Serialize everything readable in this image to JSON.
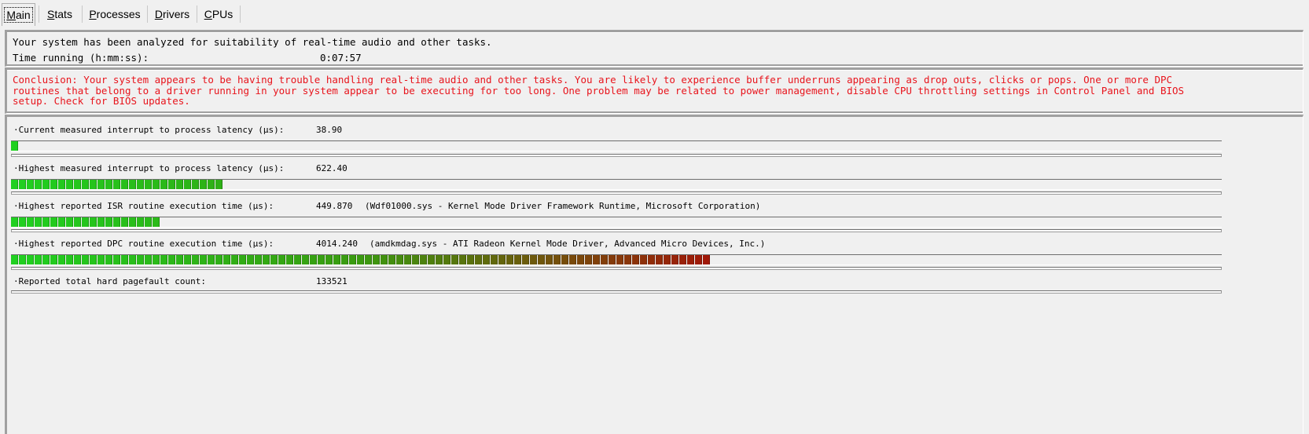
{
  "tabs": [
    {
      "label": "Main",
      "active": true
    },
    {
      "label": "Stats",
      "active": false
    },
    {
      "label": "Processes",
      "active": false
    },
    {
      "label": "Drivers",
      "active": false
    },
    {
      "label": "CPUs",
      "active": false
    }
  ],
  "summary": {
    "analyzed_text": "Your system has been analyzed for suitability of real-time audio and other tasks.",
    "time_running_label": "Time running (h:mm:ss):",
    "time_running_value": "0:07:57"
  },
  "conclusion": {
    "text": "Conclusion: Your system appears to be having trouble handling real-time audio and other tasks. You are likely to experience buffer underruns appearing as drop outs, clicks or pops. One or more DPC routines that belong to a driver running in your system appear to be executing for too long. One problem may be related to power management, disable CPU throttling settings in Control Panel and BIOS setup. Check for BIOS updates.",
    "color": "#e8141c"
  },
  "metrics": [
    {
      "label": "·Current measured interrupt to process latency (µs):",
      "value": "38.90",
      "extra": "",
      "bar_segments": 1
    },
    {
      "label": "·Highest measured interrupt to process latency (µs):",
      "value": "622.40",
      "extra": "",
      "bar_segments": 27
    },
    {
      "label": "·Highest reported ISR routine execution time (µs):",
      "value": "449.870",
      "extra": "(Wdf01000.sys - Kernel Mode Driver Framework Runtime, Microsoft Corporation)",
      "bar_segments": 19
    },
    {
      "label": "·Highest reported DPC routine execution time (µs):",
      "value": "4014.240",
      "extra": "(amdkmdag.sys - ATI Radeon Kernel Mode Driver, Advanced Micro Devices, Inc.)",
      "bar_segments": 89
    },
    {
      "label": "·Reported total hard pagefault count:",
      "value": "133521",
      "extra": ""
    }
  ],
  "colors": {
    "bar_start": "#20d020",
    "bar_mid": "#3a9a10",
    "bar_end": "#a01808",
    "text_alert": "#e8141c"
  }
}
